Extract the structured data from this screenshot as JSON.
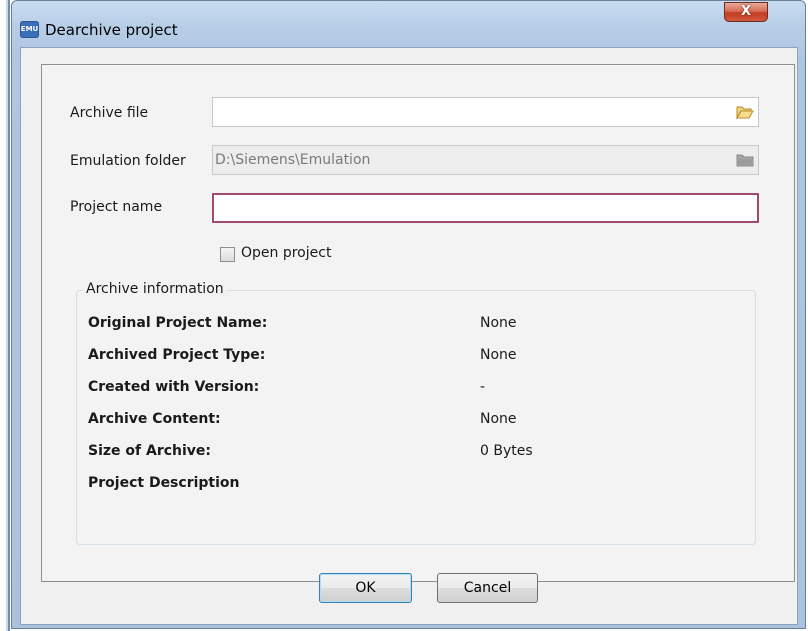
{
  "window": {
    "title": "Dearchive project",
    "app_icon_text": "EMU",
    "close_label": "X"
  },
  "form": {
    "archive_file": {
      "label": "Archive file",
      "value": ""
    },
    "emulation_folder": {
      "label": "Emulation folder",
      "value": "D:\\Siemens\\Emulation"
    },
    "project_name": {
      "label": "Project name",
      "value": ""
    },
    "open_project": {
      "label": "Open project",
      "checked": false
    }
  },
  "archive_info": {
    "title": "Archive information",
    "rows": [
      {
        "key": "Original Project Name:",
        "value": "None"
      },
      {
        "key": "Archived Project Type:",
        "value": "None"
      },
      {
        "key": "Created with Version:",
        "value": "-"
      },
      {
        "key": "Archive Content:",
        "value": "None"
      },
      {
        "key": "Size of Archive:",
        "value": "0 Bytes"
      },
      {
        "key": "Project Description",
        "value": ""
      }
    ]
  },
  "buttons": {
    "ok": "OK",
    "cancel": "Cancel"
  },
  "icons": {
    "app": "emu-app-icon",
    "archive_browse": "open-folder-icon",
    "emulation_browse": "folder-icon"
  },
  "colors": {
    "title_bar": "#b6cde7",
    "close_button": "#c33b22",
    "focus_border": "#a24a6d",
    "folder_icon": "#e8b54a"
  }
}
